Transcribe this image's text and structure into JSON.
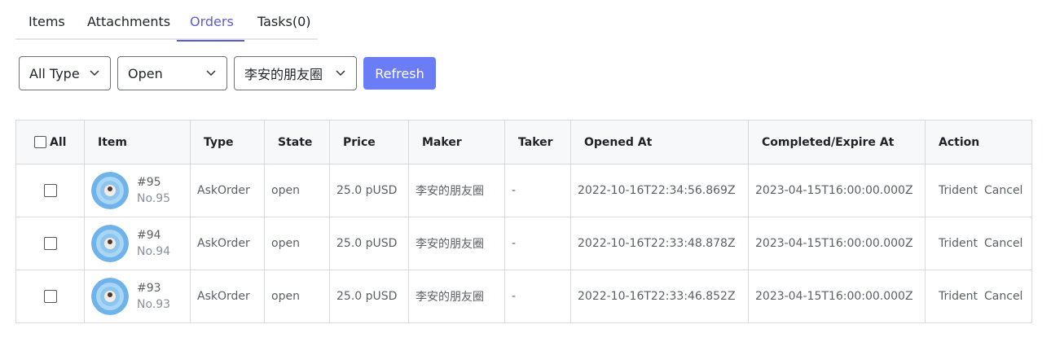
{
  "tabs": [
    {
      "label": "Items",
      "active": false
    },
    {
      "label": "Attachments",
      "active": false
    },
    {
      "label": "Orders",
      "active": true
    },
    {
      "label": "Tasks(0)",
      "active": false
    }
  ],
  "filters": {
    "type_value": "All Type",
    "state_value": "Open",
    "maker_value": "李安的朋友圈",
    "refresh_label": "Refresh"
  },
  "table": {
    "headers": {
      "all": "All",
      "item": "Item",
      "type": "Type",
      "state": "State",
      "price": "Price",
      "maker": "Maker",
      "taker": "Taker",
      "opened_at": "Opened At",
      "completed_at": "Completed/Expire At",
      "action": "Action"
    },
    "rows": [
      {
        "item_id": "#95",
        "item_no": "No.95",
        "type": "AskOrder",
        "state": "open",
        "price": "25.0 pUSD",
        "maker": "李安的朋友圈",
        "taker": "-",
        "opened_at": "2022-10-16T22:34:56.869Z",
        "completed_at": "2023-04-15T16:00:00.000Z",
        "action1": "Trident",
        "action2": "Cancel"
      },
      {
        "item_id": "#94",
        "item_no": "No.94",
        "type": "AskOrder",
        "state": "open",
        "price": "25.0 pUSD",
        "maker": "李安的朋友圈",
        "taker": "-",
        "opened_at": "2022-10-16T22:33:48.878Z",
        "completed_at": "2023-04-15T16:00:00.000Z",
        "action1": "Trident",
        "action2": "Cancel"
      },
      {
        "item_id": "#93",
        "item_no": "No.93",
        "type": "AskOrder",
        "state": "open",
        "price": "25.0 pUSD",
        "maker": "李安的朋友圈",
        "taker": "-",
        "opened_at": "2022-10-16T22:33:46.852Z",
        "completed_at": "2023-04-15T16:00:00.000Z",
        "action1": "Trident",
        "action2": "Cancel"
      }
    ]
  },
  "colors": {
    "accent": "#5b5bd6",
    "button": "#6b7cf7"
  }
}
